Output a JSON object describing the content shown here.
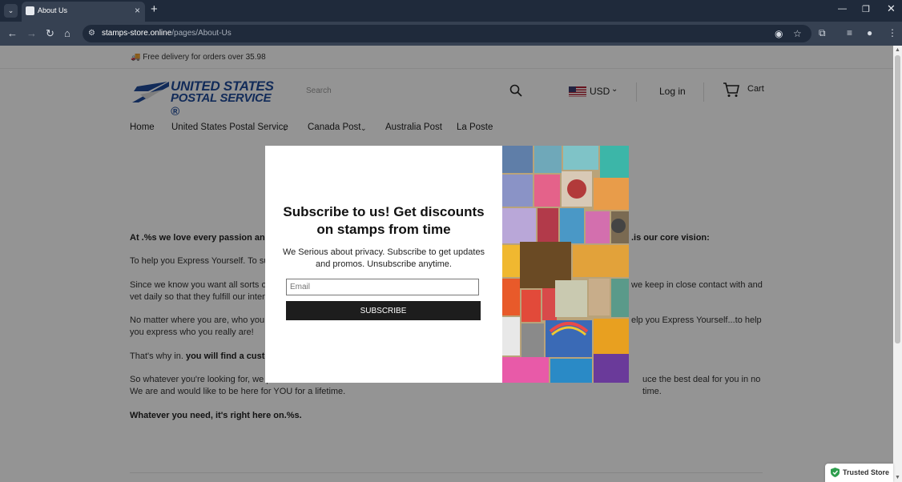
{
  "browser": {
    "tab_title": "About Us",
    "url_domain": "stamps-store.online",
    "url_path": "/pages/About-Us"
  },
  "announcement": "🚚 Free delivery for orders over 35.98",
  "header": {
    "logo_line1": "UNITED STATES",
    "logo_line2": "POSTAL SERVICE ®",
    "search_placeholder": "Search",
    "currency": "USD",
    "login": "Log in",
    "cart": "Cart"
  },
  "nav": {
    "items": [
      "Home",
      "United States Postal Service",
      "Canada Post",
      "Australia Post",
      "La Poste"
    ]
  },
  "content": {
    "p1_a": "At .%s we love every passion and ",
    "p1_b": ".is our core vision:",
    "p2": "To help you Express Yourself. To sup",
    "p3_a": "Since we know you want all sorts of ",
    "p3_b": "we keep in close contact with and",
    "p3_c": "vet daily so that they fulfill our intense",
    "p4_a": "No matter where you are, who you ar",
    "p4_b": "elp you Express Yourself...to help",
    "p4_c": "you express who you really are!",
    "p5_a": "That's why in. ",
    "p5_b": "you will find a custom",
    "p6_a": "So whatever you're looking for, we pl",
    "p6_b": "uce the best deal for you in no time.",
    "p6_c": "We are and would like to be here for YOU for a lifetime.",
    "p7": "Whatever you need, it's right here on.%s."
  },
  "modal": {
    "title": "Subscribe to us! Get discounts on stamps from time",
    "description": "We Serious about privacy. Subscribe to get updates and promos. Unsubscribe anytime.",
    "email_placeholder": "Email",
    "subscribe_label": "SUBSCRIBE",
    "close": "×"
  },
  "badge": {
    "trusted": "Trusted Store"
  }
}
